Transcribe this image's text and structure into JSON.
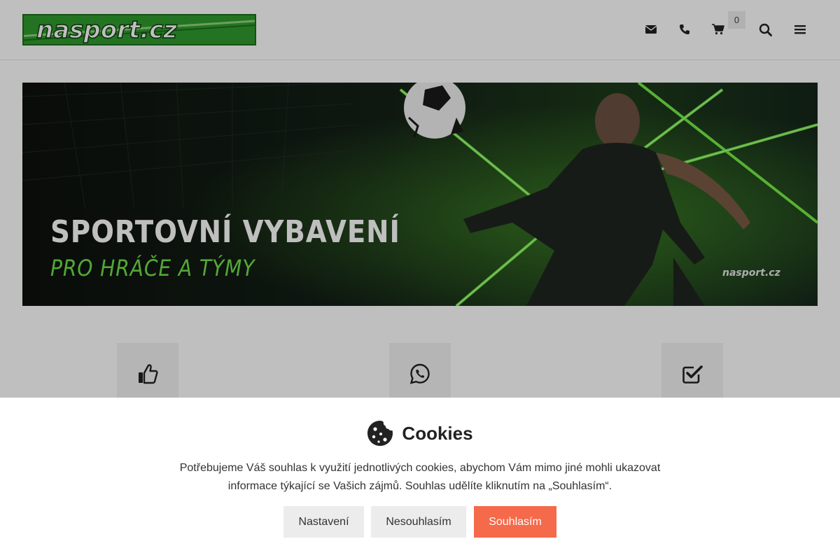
{
  "header": {
    "logo_text": "nasport.cz",
    "cart_count": "0",
    "icons": [
      "envelope-icon",
      "phone-icon",
      "cart-icon",
      "search-icon",
      "menu-icon"
    ]
  },
  "banner": {
    "title": "SPORTOVNÍ VYBAVENÍ",
    "subtitle": "PRO HRÁČE A TÝMY",
    "watermark": "nasport.cz"
  },
  "features": [
    {
      "icon": "thumbs-up-icon"
    },
    {
      "icon": "whatsapp-icon"
    },
    {
      "icon": "check-square-icon"
    }
  ],
  "cookies": {
    "title": "Cookies",
    "text": "Potřebujeme Váš souhlas k využití jednotlivých cookies, abychom Vám mimo jiné mohli ukazovat informace týkající se Vašich zájmů. Souhlas udělíte kliknutím na „Souhlasím“.",
    "settings_label": "Nastavení",
    "reject_label": "Nesouhlasím",
    "accept_label": "Souhlasím"
  },
  "colors": {
    "brand_green": "#2f9a2f",
    "accent_green": "#6fe04a",
    "accept_button": "#f46a4a"
  }
}
